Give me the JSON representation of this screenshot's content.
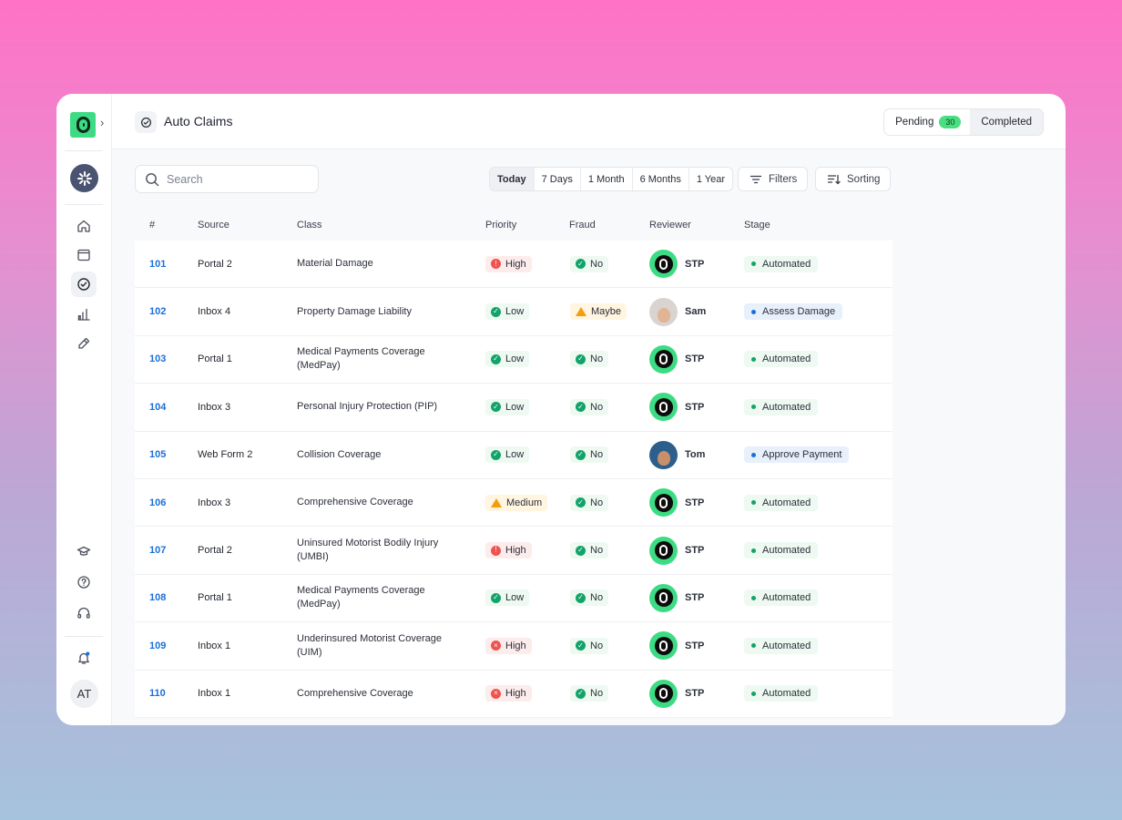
{
  "header": {
    "title": "Auto Claims",
    "pending_label": "Pending",
    "pending_count": "30",
    "completed_label": "Completed"
  },
  "sidebar": {
    "user_initials": "AT",
    "icons": [
      "home-icon",
      "window-icon",
      "check-circle-icon",
      "bar-chart-icon",
      "pencil-icon",
      "graduation-cap-icon",
      "help-icon",
      "headset-icon",
      "bell-icon"
    ]
  },
  "toolbar": {
    "search_placeholder": "Search",
    "ranges": [
      "Today",
      "7 Days",
      "1 Month",
      "6 Months",
      "1 Year"
    ],
    "selected_range": "Today",
    "filters_label": "Filters",
    "sorting_label": "Sorting"
  },
  "table": {
    "columns": [
      "#",
      "Source",
      "Class",
      "Priority",
      "Fraud",
      "Reviewer",
      "Stage"
    ],
    "rows": [
      {
        "id": "101",
        "source": "Portal 2",
        "class_l1": "Material Damage",
        "class_l2": "",
        "priority": "High",
        "priority_level": "high",
        "fraud": "No",
        "fraud_level": "no",
        "reviewer": "STP",
        "reviewer_type": "stp",
        "stage": "Automated",
        "stage_type": "auto"
      },
      {
        "id": "102",
        "source": "Inbox 4",
        "class_l1": "Property Damage Liability",
        "class_l2": "",
        "priority": "Low",
        "priority_level": "low",
        "fraud": "Maybe",
        "fraud_level": "maybe",
        "reviewer": "Sam",
        "reviewer_type": "sam",
        "stage": "Assess Damage",
        "stage_type": "assess"
      },
      {
        "id": "103",
        "source": "Portal 1",
        "class_l1": "Medical Payments Coverage",
        "class_l2": "(MedPay)",
        "priority": "Low",
        "priority_level": "low",
        "fraud": "No",
        "fraud_level": "no",
        "reviewer": "STP",
        "reviewer_type": "stp",
        "stage": "Automated",
        "stage_type": "auto"
      },
      {
        "id": "104",
        "source": "Inbox 3",
        "class_l1": "Personal Injury Protection (PIP)",
        "class_l2": "",
        "priority": "Low",
        "priority_level": "low",
        "fraud": "No",
        "fraud_level": "no",
        "reviewer": "STP",
        "reviewer_type": "stp",
        "stage": "Automated",
        "stage_type": "auto"
      },
      {
        "id": "105",
        "source": "Web Form 2",
        "class_l1": "Collision Coverage",
        "class_l2": "",
        "priority": "Low",
        "priority_level": "low",
        "fraud": "No",
        "fraud_level": "no",
        "reviewer": "Tom",
        "reviewer_type": "tom",
        "stage": "Approve Payment",
        "stage_type": "approve"
      },
      {
        "id": "106",
        "source": "Inbox 3",
        "class_l1": "Comprehensive Coverage",
        "class_l2": "",
        "priority": "Medium",
        "priority_level": "medium",
        "fraud": "No",
        "fraud_level": "no",
        "reviewer": "STP",
        "reviewer_type": "stp",
        "stage": "Automated",
        "stage_type": "auto"
      },
      {
        "id": "107",
        "source": "Portal 2",
        "class_l1": "Uninsured Motorist Bodily Injury",
        "class_l2": "(UMBI)",
        "priority": "High",
        "priority_level": "high",
        "fraud": "No",
        "fraud_level": "no",
        "reviewer": "STP",
        "reviewer_type": "stp",
        "stage": "Automated",
        "stage_type": "auto"
      },
      {
        "id": "108",
        "source": "Portal 1",
        "class_l1": "Medical Payments Coverage",
        "class_l2": "(MedPay)",
        "priority": "Low",
        "priority_level": "low",
        "fraud": "No",
        "fraud_level": "no",
        "reviewer": "STP",
        "reviewer_type": "stp",
        "stage": "Automated",
        "stage_type": "auto"
      },
      {
        "id": "109",
        "source": "Inbox 1",
        "class_l1": "Underinsured Motorist Coverage",
        "class_l2": "(UIM)",
        "priority": "High",
        "priority_level": "high-x",
        "fraud": "No",
        "fraud_level": "no",
        "reviewer": "STP",
        "reviewer_type": "stp",
        "stage": "Automated",
        "stage_type": "auto"
      },
      {
        "id": "110",
        "source": "Inbox 1",
        "class_l1": "Comprehensive Coverage",
        "class_l2": "",
        "priority": "High",
        "priority_level": "high-x",
        "fraud": "No",
        "fraud_level": "no",
        "reviewer": "STP",
        "reviewer_type": "stp",
        "stage": "Automated",
        "stage_type": "auto"
      }
    ]
  },
  "colors": {
    "accent_green": "#3ddc84",
    "link_blue": "#1a6fd8",
    "danger": "#ef5350",
    "warning": "#f59e0b"
  }
}
